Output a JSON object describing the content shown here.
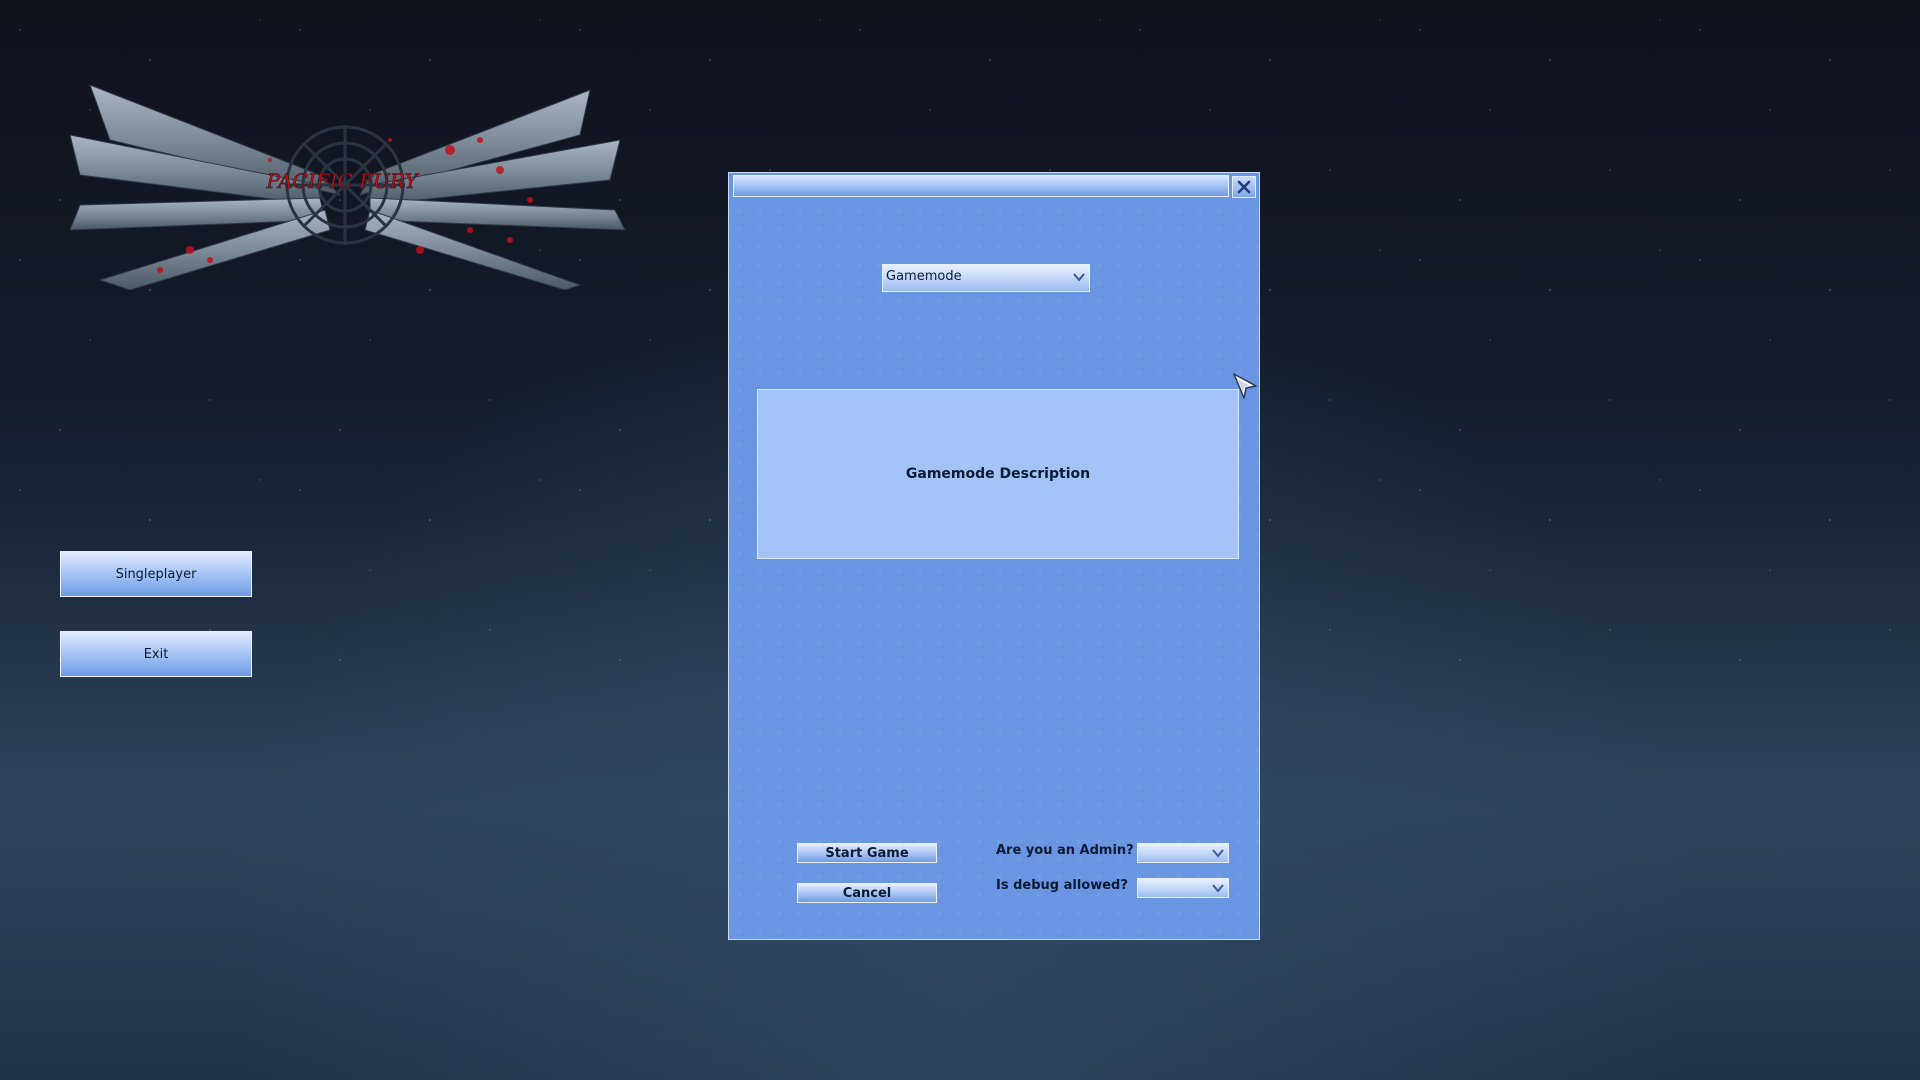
{
  "logo": {
    "text": "PACIFIC FURY"
  },
  "main_menu": {
    "items": [
      {
        "label": "Singleplayer"
      },
      {
        "label": "Exit"
      }
    ]
  },
  "dialog": {
    "title": "",
    "gamemode_select": {
      "value": "Gamemode"
    },
    "description": "Gamemode Description",
    "start_label": "Start Game",
    "cancel_label": "Cancel",
    "admin_label": "Are you an Admin?",
    "admin_select": {
      "value": ""
    },
    "debug_label": "Is debug allowed?",
    "debug_select": {
      "value": ""
    }
  },
  "colors": {
    "dialog_bg": "#6a95e2",
    "description_bg": "#a3c2f5",
    "logo_blood": "#c0101a",
    "text": "#0b1b33"
  },
  "icons": [
    "logo-emblem",
    "close-icon",
    "chevron-down-icon",
    "mouse-cursor-icon"
  ]
}
